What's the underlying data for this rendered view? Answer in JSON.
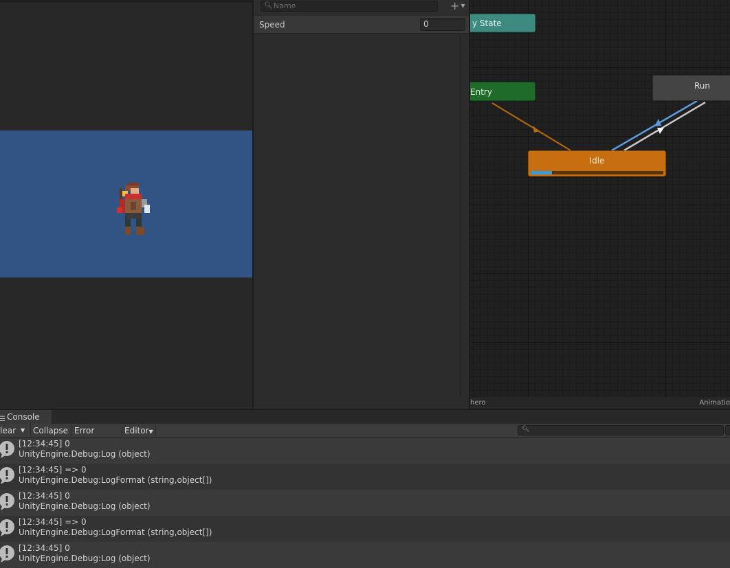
{
  "game_view": {
    "background": "#282828",
    "canvas_color": "#325484",
    "hero_icon": "hero-sprite"
  },
  "parameters": {
    "search_placeholder": "Name",
    "add_icon": "plus-icon",
    "items": [
      {
        "name": "Speed",
        "value": "0"
      }
    ]
  },
  "animator": {
    "states": {
      "any": "y State",
      "entry": "Entry",
      "idle": "Idle",
      "run": "Run"
    },
    "idle_progress": 0.16,
    "colors": {
      "any_state": "#3d8b80",
      "entry": "#1f6b2a",
      "idle_default": "#c66e10",
      "transition_entry": "#b86a0a",
      "transition_active": "#5b9bdc",
      "transition_default": "#c8c8c8"
    },
    "footer": {
      "breadcrumb": "hero",
      "label": "Animatio"
    }
  },
  "console": {
    "tab_label": "Console",
    "toolbar": {
      "clear": "lear",
      "collapse": "Collapse",
      "error_pause": "Error Pause",
      "editor": "Editor"
    },
    "search_placeholder": "",
    "entries": [
      {
        "line1": "[12:34:45] 0",
        "line2": "UnityEngine.Debug:Log (object)"
      },
      {
        "line1": "[12:34:45] => 0",
        "line2": "UnityEngine.Debug:LogFormat (string,object[])"
      },
      {
        "line1": "[12:34:45] 0",
        "line2": "UnityEngine.Debug:Log (object)"
      },
      {
        "line1": "[12:34:45] => 0",
        "line2": "UnityEngine.Debug:LogFormat (string,object[])"
      },
      {
        "line1": "[12:34:45] 0",
        "line2": "UnityEngine.Debug:Log (object)"
      }
    ]
  }
}
